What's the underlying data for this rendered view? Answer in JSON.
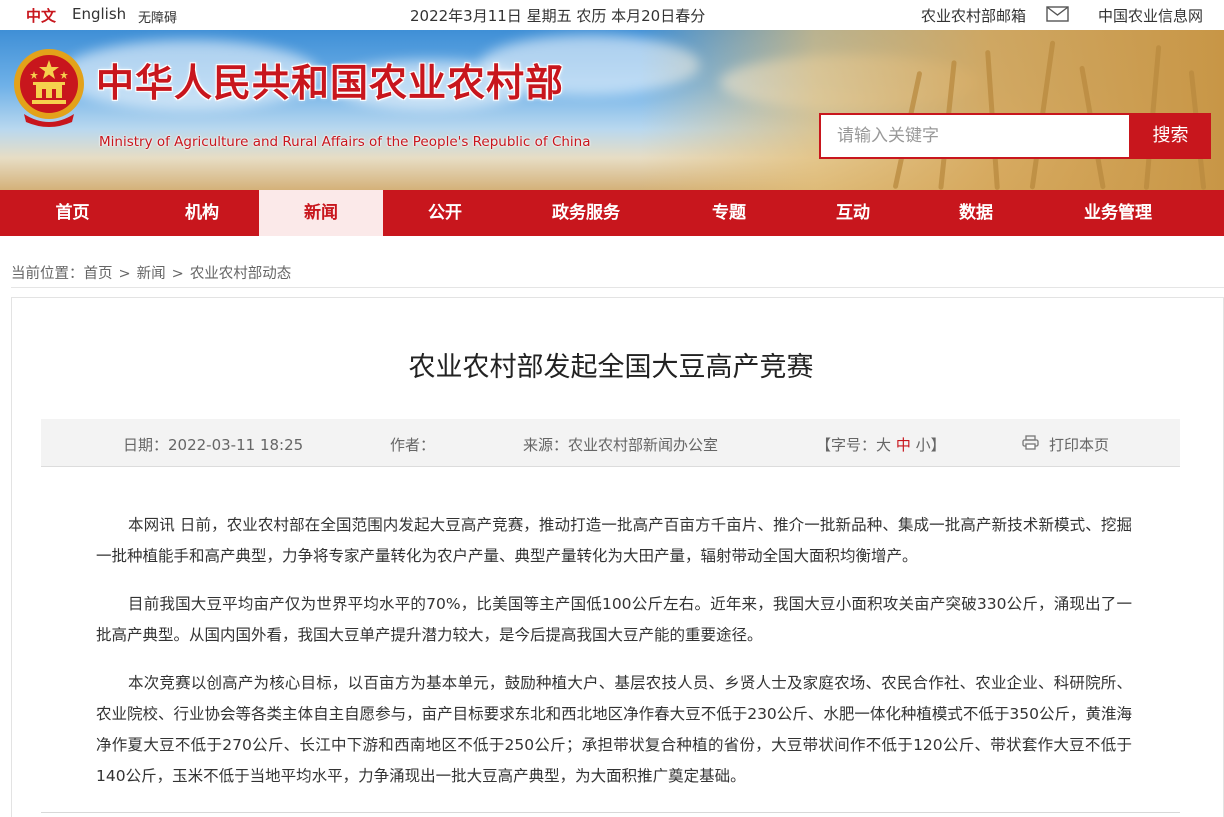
{
  "topbar": {
    "lang_cn": "中文",
    "lang_en": "English",
    "accessibility": "无障碍",
    "date": "2022年3月11日 星期五 农历 本月20日春分",
    "mail": "农业农村部邮箱",
    "info_net": "中国农业信息网"
  },
  "header": {
    "title": "中华人民共和国农业农村部",
    "subtitle": "Ministry of Agriculture and Rural Affairs of the People's Republic of China",
    "search_placeholder": "请输入关键字",
    "search_button": "搜索"
  },
  "nav": {
    "items": [
      "首页",
      "机构",
      "新闻",
      "公开",
      "政务服务",
      "专题",
      "互动",
      "数据",
      "业务管理"
    ],
    "active": "新闻"
  },
  "breadcrumb": {
    "prefix": "当前位置：",
    "items": [
      "首页",
      "新闻",
      "农业农村部动态"
    ]
  },
  "article": {
    "title": "农业农村部发起全国大豆高产竞赛",
    "date_label": "日期：2022-03-11 18:25",
    "author_label": "作者：",
    "source_label": "来源：农业农村部新闻办公室",
    "font_size_open": "【字号：",
    "font_large": "大",
    "font_medium": "中",
    "font_small": "小",
    "font_size_close": "】",
    "print": "打印本页",
    "paragraphs": [
      "本网讯 日前，农业农村部在全国范围内发起大豆高产竞赛，推动打造一批高产百亩方千亩片、推介一批新品种、集成一批高产新技术新模式、挖掘一批种植能手和高产典型，力争将专家产量转化为农户产量、典型产量转化为大田产量，辐射带动全国大面积均衡增产。",
      "目前我国大豆平均亩产仅为世界平均水平的70%，比美国等主产国低100公斤左右。近年来，我国大豆小面积攻关亩产突破330公斤，涌现出了一批高产典型。从国内国外看，我国大豆单产提升潜力较大，是今后提高我国大豆产能的重要途径。",
      "本次竞赛以创高产为核心目标，以百亩方为基本单元，鼓励种植大户、基层农技人员、乡贤人士及家庭农场、农民合作社、农业企业、科研院所、农业院校、行业协会等各类主体自主自愿参与，亩产目标要求东北和西北地区净作春大豆不低于230公斤、水肥一体化种植模式不低于350公斤，黄淮海净作夏大豆不低于270公斤、长江中下游和西南地区不低于250公斤；承担带状复合种植的省份，大豆带状间作不低于120公斤、带状套作大豆不低于140公斤，玉米不低于当地平均水平，力争涌现出一批大豆高产典型，为大面积推广奠定基础。"
    ]
  },
  "colors": {
    "brand_red": "#c8161d",
    "nav_active_bg": "#fbe9e9",
    "meta_bg": "#f3f3f3"
  }
}
